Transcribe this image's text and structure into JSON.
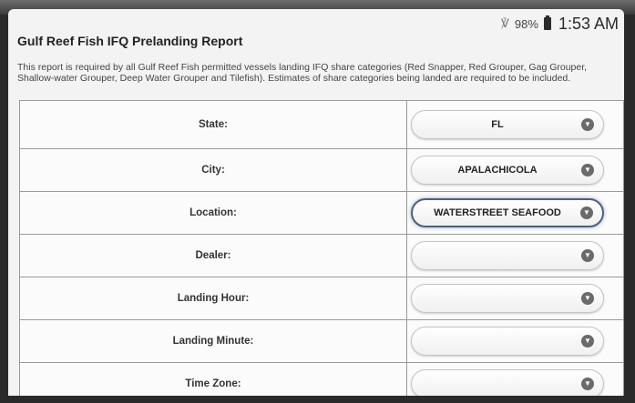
{
  "status": {
    "battery": "98%",
    "time": "1:53 AM"
  },
  "app": {
    "title": "Gulf Reef Fish IFQ Prelanding Report",
    "intro": "This report is required by all Gulf Reef Fish permitted vessels landing IFQ share categories (Red Snapper, Red Grouper, Gag Grouper, Shallow-water Grouper, Deep Water Grouper and Tilefish). Estimates of share categories being landed are required to be included."
  },
  "form": {
    "fields": [
      {
        "label": "State:",
        "value": "FL"
      },
      {
        "label": "City:",
        "value": "APALACHICOLA"
      },
      {
        "label": "Location:",
        "value": "WATERSTREET SEAFOOD"
      },
      {
        "label": "Dealer:",
        "value": ""
      },
      {
        "label": "Landing Hour:",
        "value": ""
      },
      {
        "label": "Landing Minute:",
        "value": ""
      },
      {
        "label": "Time Zone:",
        "value": ""
      }
    ]
  },
  "icons": {
    "dropdown": "chevron-down-icon",
    "battery": "battery-icon",
    "wifi": "wifi-icon"
  }
}
